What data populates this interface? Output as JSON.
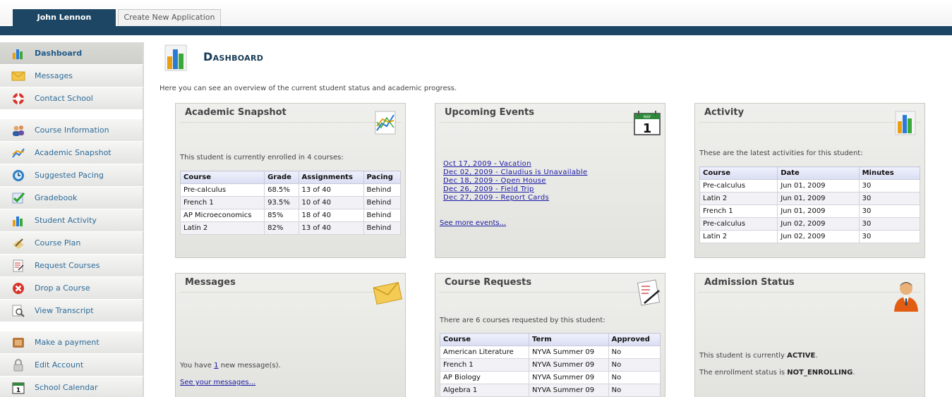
{
  "tabs": {
    "active": "John Lennon",
    "inactive": "Create New Application"
  },
  "sidebar": {
    "group1": [
      {
        "label": "Dashboard",
        "icon": "bar-chart-icon"
      },
      {
        "label": "Messages",
        "icon": "envelope-icon"
      },
      {
        "label": "Contact School",
        "icon": "lifebuoy-icon"
      }
    ],
    "group2": [
      {
        "label": "Course Information",
        "icon": "users-icon"
      },
      {
        "label": "Academic Snapshot",
        "icon": "line-chart-icon"
      },
      {
        "label": "Suggested Pacing",
        "icon": "clock-globe-icon"
      },
      {
        "label": "Gradebook",
        "icon": "checkmark-icon"
      },
      {
        "label": "Student Activity",
        "icon": "bar-chart-icon"
      },
      {
        "label": "Course Plan",
        "icon": "pencil-icon"
      },
      {
        "label": "Request Courses",
        "icon": "form-icon"
      },
      {
        "label": "Drop a Course",
        "icon": "delete-icon"
      },
      {
        "label": "View Transcript",
        "icon": "magnifier-icon"
      }
    ],
    "group3": [
      {
        "label": "Make a payment",
        "icon": "wallet-icon"
      },
      {
        "label": "Edit Account",
        "icon": "lock-icon"
      },
      {
        "label": "School Calendar",
        "icon": "calendar-icon"
      }
    ]
  },
  "page": {
    "title": "Dashboard",
    "intro": "Here you can see an overview of the current student status and academic progress."
  },
  "snapshot": {
    "title": "Academic Snapshot",
    "text": "This student is currently enrolled in 4 courses:",
    "headers": [
      "Course",
      "Grade",
      "Assignments",
      "Pacing"
    ],
    "rows": [
      [
        "Pre-calculus",
        "68.5%",
        "13 of 40",
        "Behind"
      ],
      [
        "French 1",
        "93.5%",
        "10 of 40",
        "Behind"
      ],
      [
        "AP Microeconomics",
        "85%",
        "18 of 40",
        "Behind"
      ],
      [
        "Latin 2",
        "82%",
        "13 of 40",
        "Behind"
      ]
    ]
  },
  "events": {
    "title": "Upcoming Events",
    "items": [
      "Oct 17, 2009 - Vacation",
      "Dec 02, 2009 - Claudius is Unavailable",
      "Dec 18, 2009 - Open House",
      "Dec 26, 2009 - Field Trip",
      "Dec 27, 2009 - Report Cards"
    ],
    "more": "See more events...",
    "calendar_day": "1",
    "calendar_month": "MAY"
  },
  "activity": {
    "title": "Activity",
    "text": "These are the latest activities for this student:",
    "headers": [
      "Course",
      "Date",
      "Minutes"
    ],
    "rows": [
      [
        "Pre-calculus",
        "Jun 01, 2009",
        "30"
      ],
      [
        "Latin 2",
        "Jun 01, 2009",
        "30"
      ],
      [
        "French 1",
        "Jun 01, 2009",
        "30"
      ],
      [
        "Pre-calculus",
        "Jun 02, 2009",
        "30"
      ],
      [
        "Latin 2",
        "Jun 02, 2009",
        "30"
      ]
    ]
  },
  "messages": {
    "title": "Messages",
    "text_before": "You have ",
    "count": "1",
    "text_after": " new message(s).",
    "link": "See your messages..."
  },
  "requests": {
    "title": "Course Requests",
    "text": "There are 6 courses requested by this student:",
    "headers": [
      "Course",
      "Term",
      "Approved"
    ],
    "rows": [
      [
        "American Literature",
        "NYVA Summer 09",
        "No"
      ],
      [
        "French 1",
        "NYVA Summer 09",
        "No"
      ],
      [
        "AP Biology",
        "NYVA Summer 09",
        "No"
      ],
      [
        "Algebra 1",
        "NYVA Summer 09",
        "No"
      ]
    ]
  },
  "admission": {
    "title": "Admission Status",
    "status_prefix": "This student is currently ",
    "status": "ACTIVE",
    "status_suffix": ".",
    "enroll_prefix": "The enrollment status is ",
    "enroll": "NOT_ENROLLING",
    "enroll_suffix": "."
  },
  "colors": {
    "navy": "#1d4664",
    "link": "#1a1aa6",
    "sidebar_text": "#2d6c99"
  }
}
